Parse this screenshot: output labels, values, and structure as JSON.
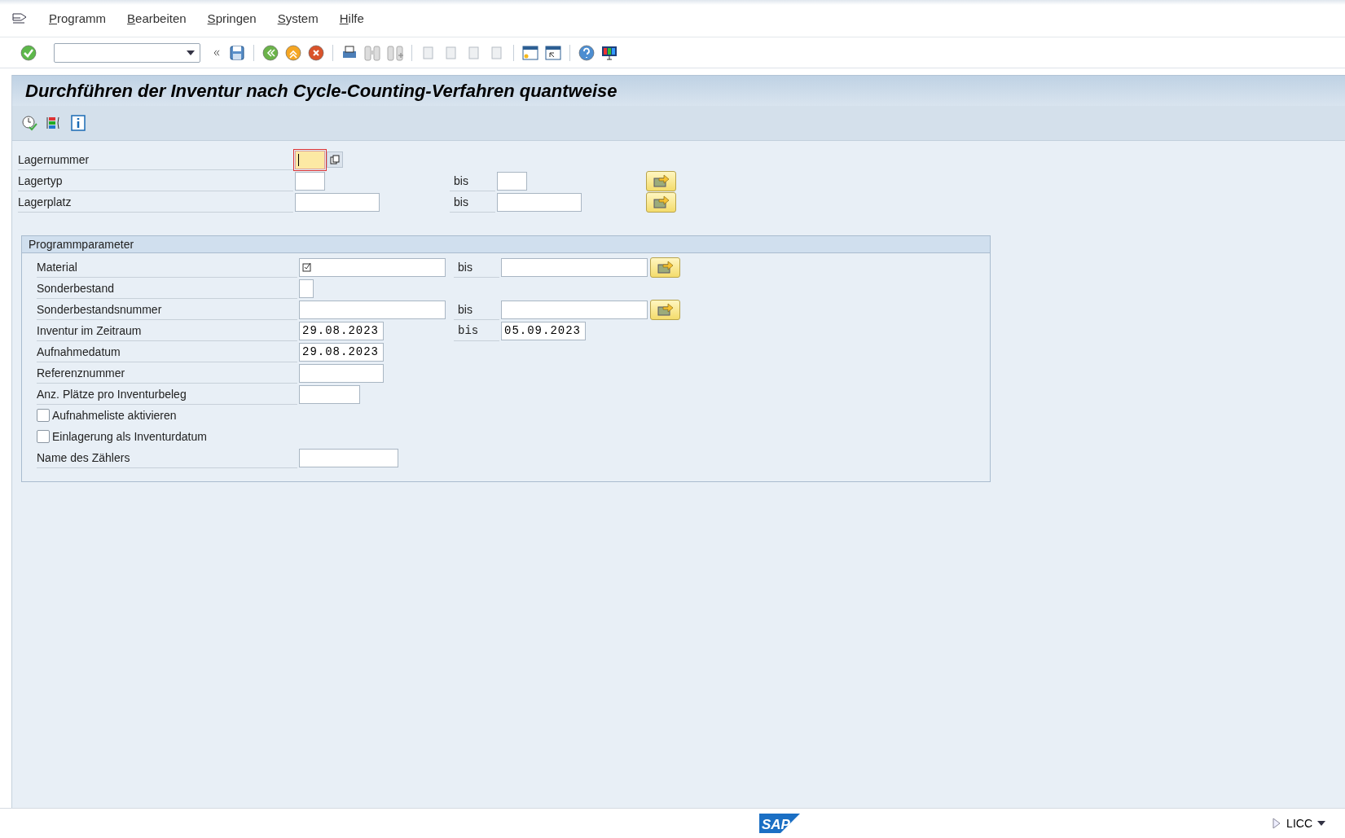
{
  "menu_bar": {
    "items": [
      "Programm",
      "Bearbeiten",
      "Springen",
      "System",
      "Hilfe"
    ]
  },
  "title": "Durchführen der Inventur nach Cycle-Counting-Verfahren quantweise",
  "selection": [
    {
      "kind": "single",
      "label": "Lagernummer",
      "focused": true
    },
    {
      "kind": "range",
      "label": "Lagertyp",
      "to_label": "bis",
      "focused": false
    },
    {
      "kind": "range",
      "label": "Lagerplatz",
      "to_label": "bis",
      "focused": false
    }
  ],
  "parameters": {
    "title": "Programmparameter",
    "rows": [
      {
        "kind": "range",
        "label": "Material",
        "to_label": "bis",
        "multi_marker": true
      },
      {
        "kind": "single",
        "label": "Sonderbestand"
      },
      {
        "kind": "range",
        "label": "Sonderbestandsnummer",
        "to_label": "bis",
        "multi_marker": false
      },
      {
        "kind": "daterange",
        "label": "Inventur im Zeitraum",
        "value": "29.08.2023",
        "to_label": "bis",
        "value_to": "05.09.2023"
      },
      {
        "kind": "single",
        "label": "Aufnahmedatum",
        "value": "29.08.2023"
      },
      {
        "kind": "single",
        "label": "Referenznummer"
      },
      {
        "kind": "single",
        "label": "Anz. Plätze pro Inventurbeleg"
      },
      {
        "kind": "checkbox",
        "label": "Aufnahmeliste aktivieren",
        "checked": false
      },
      {
        "kind": "checkbox",
        "label": "Einlagerung als Inventurdatum",
        "checked": false
      },
      {
        "kind": "single",
        "label": "Name des Zählers"
      }
    ]
  },
  "status_bar": {
    "logo": "SAP",
    "transaction": "LICC"
  }
}
